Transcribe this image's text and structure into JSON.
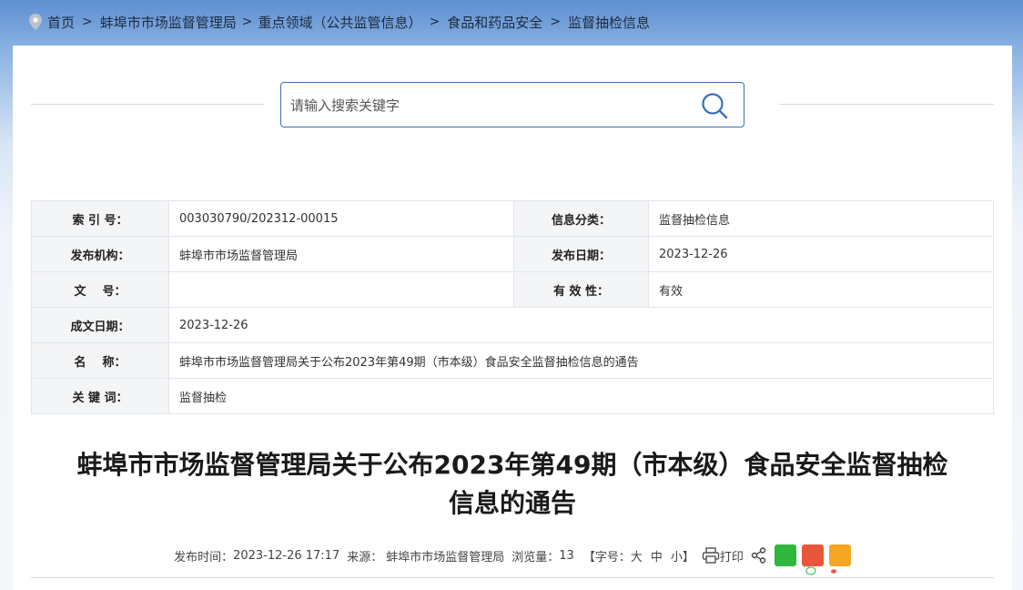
{
  "breadcrumb": {
    "home": "首页",
    "sep": ">",
    "item1": "蚌埠市市场监督管理局",
    "item2": "重点领域（公共监管信息）",
    "item3": "食品和药品安全",
    "item4": "监督抽检信息"
  },
  "search": {
    "placeholder": "请输入搜索关键字"
  },
  "meta": {
    "index_label": "索 引 号：",
    "index_value": "003030790/202312-00015",
    "category_label": "信息分类：",
    "category_value": "监督抽检信息",
    "publisher_label": "发布机构：",
    "publisher_value": "蚌埠市市场监督管理局",
    "pubdate_label": "发布日期：",
    "pubdate_value": "2023-12-26",
    "docno_label": "文    号：",
    "docno_value": "",
    "validity_label": "有 效 性：",
    "validity_value": "有效",
    "created_label": "成文日期：",
    "created_value": "2023-12-26",
    "name_label": "名    称：",
    "name_value": "蚌埠市市场监督管理局关于公布2023年第49期（市本级）食品安全监督抽检信息的通告",
    "keywords_label": "关 键 词：",
    "keywords_value": "监督抽检"
  },
  "article": {
    "title_line1": "蚌埠市市场监督管理局关于公布2023年第49期（市本级）食品安全监督抽检",
    "title_line2": "信息的通告"
  },
  "info": {
    "time_label": "发布时间：",
    "time_value": "2023-12-26 17:17",
    "source_label": "来源：",
    "source_value": "蚌埠市市场监督管理局",
    "views_label": "浏览量：",
    "views_value": "13",
    "fontsize_open": "【字号：",
    "size_large": "大",
    "size_medium": "中",
    "size_small": "小",
    "fontsize_close": "】",
    "print": "打印"
  },
  "colors": {
    "accent": "#3a6fb8",
    "wechat": "#2db83d",
    "weibo": "#e8573b",
    "qzone": "#f5a623"
  }
}
